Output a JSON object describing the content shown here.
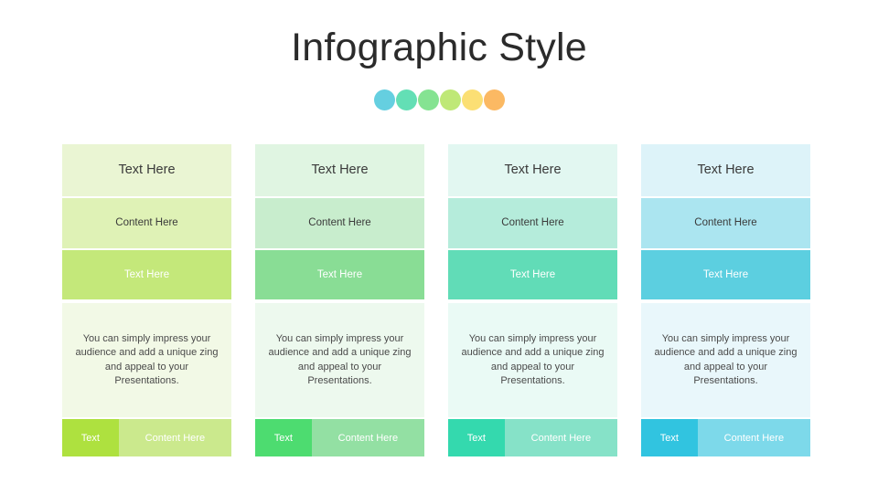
{
  "slide": {
    "title": "Infographic Style",
    "background": "#ffffff"
  },
  "dots": [
    {
      "name": "dot-cyan",
      "color": "#65cfe0"
    },
    {
      "name": "dot-teal",
      "color": "#63dfb5"
    },
    {
      "name": "dot-green",
      "color": "#85e392"
    },
    {
      "name": "dot-yellowgreen",
      "color": "#bfe877"
    },
    {
      "name": "dot-yellow",
      "color": "#fbdf74"
    },
    {
      "name": "dot-orange",
      "color": "#fbb963"
    }
  ],
  "columns": [
    {
      "id": "column-1",
      "head_label": "Text Here",
      "sub_label": "Content Here",
      "accent_label": "Text Here",
      "body_text": "You can simply impress your audience and add a unique zing and appeal to your Presentations.",
      "footer_left_label": "Text",
      "footer_right_label": "Content Here",
      "colors": {
        "head_bg": "#eaf5d3",
        "sub_bg": "#dff2b6",
        "accent_bg": "#c4e87a",
        "body_bg": "#f2f9e6",
        "footer_left_bg": "#aee13f",
        "footer_right_bg": "#cbe98d"
      }
    },
    {
      "id": "column-2",
      "head_label": "Text Here",
      "sub_label": "Content Here",
      "accent_label": "Text Here",
      "body_text": "You can simply impress your audience and add a unique zing and appeal to your Presentations.",
      "footer_left_label": "Text",
      "footer_right_label": "Content Here",
      "colors": {
        "head_bg": "#e0f5e2",
        "sub_bg": "#c8edcd",
        "accent_bg": "#89dd95",
        "body_bg": "#edf9ee",
        "footer_left_bg": "#4ddc70",
        "footer_right_bg": "#93e0a3"
      }
    },
    {
      "id": "column-3",
      "head_label": "Text Here",
      "sub_label": "Content Here",
      "accent_label": "Text Here",
      "body_text": "You can simply impress your audience and add a unique zing and appeal to your Presentations.",
      "footer_left_label": "Text",
      "footer_right_label": "Content Here",
      "colors": {
        "head_bg": "#e2f7f1",
        "sub_bg": "#b5ecdb",
        "accent_bg": "#61dcb7",
        "body_bg": "#eafaf5",
        "footer_left_bg": "#34d9ae",
        "footer_right_bg": "#86e2c8"
      }
    },
    {
      "id": "column-4",
      "head_label": "Text Here",
      "sub_label": "Content Here",
      "accent_label": "Text Here",
      "body_text": "You can simply impress your audience and add a unique zing and appeal to your Presentations.",
      "footer_left_label": "Text",
      "footer_right_label": "Content Here",
      "colors": {
        "head_bg": "#ddf3f9",
        "sub_bg": "#abe5f0",
        "accent_bg": "#5ccfe0",
        "body_bg": "#e9f7fb",
        "footer_left_bg": "#31c4e0",
        "footer_right_bg": "#7dd9ea"
      }
    }
  ]
}
